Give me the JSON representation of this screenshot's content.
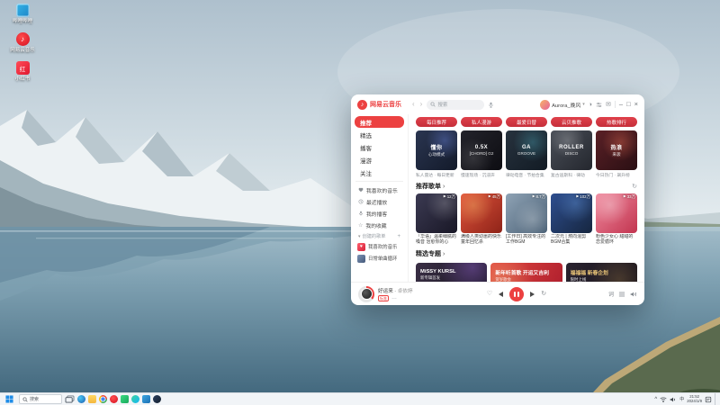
{
  "accent_color": "#ec4141",
  "desktop": {
    "icons": [
      {
        "label": "哔哩哔哩"
      },
      {
        "label": "网易云音乐"
      },
      {
        "label": "小红书"
      }
    ]
  },
  "taskbar": {
    "search_placeholder": "搜索",
    "apps": [
      "task-view",
      "edge",
      "file-explorer",
      "chrome",
      "netease-music",
      "wechat",
      "qq-music",
      "vscode",
      "steam"
    ],
    "tray": {
      "lang": "中",
      "time": "21:52",
      "date": "2024/1/9"
    }
  },
  "app": {
    "name": "网易云音乐",
    "header": {
      "search_placeholder": "搜索",
      "user_name": "Aurora_晚风"
    },
    "sidebar": {
      "nav": [
        {
          "label": "推荐"
        },
        {
          "label": "精选"
        },
        {
          "label": "播客"
        },
        {
          "label": "漫游"
        },
        {
          "label": "关注"
        }
      ],
      "library": [
        {
          "label": "我喜欢的音乐"
        },
        {
          "label": "最近播放"
        },
        {
          "label": "我的播客"
        },
        {
          "label": "我的收藏"
        }
      ],
      "playlists_header": "创建的歌单",
      "playlists": [
        {
          "title": "我喜欢的音乐"
        },
        {
          "title": "日常单曲循环"
        }
      ]
    },
    "main": {
      "chips": [
        {
          "label": "每日推荐"
        },
        {
          "label": "私人漫游"
        },
        {
          "label": "最爱日替"
        },
        {
          "label": "云贝推歌"
        },
        {
          "label": "热歌排行"
        }
      ],
      "featured_cards": [
        {
          "line1": "懂你",
          "line2": "心动模式",
          "caption": "私人雷达 · 每日更新"
        },
        {
          "line1": "0.5X",
          "line2": "[CHORD] G2",
          "caption": "慢速现场 · 沉浸声"
        },
        {
          "line1": "GA",
          "line2": "GROOVE",
          "caption": "律动电音 · 节拍合集"
        },
        {
          "line1": "ROLLER",
          "line2": "DISCO",
          "caption": "复古迪斯科 · 律动"
        },
        {
          "line1": "热浪",
          "line2": "来袭",
          "caption": "今日热门 · 飙升榜"
        }
      ],
      "section_recommend": {
        "title": "推荐歌单",
        "more": "›"
      },
      "recommend_playlists": [
        {
          "plays": "12万",
          "title": "「华语」温柔细腻的嗓音 治愈你的心"
        },
        {
          "plays": "45万",
          "title": "满级人类幼崽的快乐 童年回忆杀"
        },
        {
          "plays": "8.7万",
          "title": "[工作日] 高效专注的工作BGM"
        },
        {
          "plays": "102万",
          "title": "二次元 | 燃向混剪BGM合集"
        },
        {
          "plays": "33万",
          "title": "粉色少女心 甜甜的恋爱循环"
        }
      ],
      "section_featured": {
        "title": "精选专题",
        "more": "›"
      },
      "banners": [
        {
          "title": "MiSSY KURSL",
          "subtitle": "新专辑首发"
        },
        {
          "title": "新年听首歌 开运又吉利",
          "subtitle": "贺岁歌会"
        },
        {
          "title": "福福福 新春企划",
          "subtitle": "限时上线"
        }
      ]
    },
    "player": {
      "song": "好运来",
      "artist": "卓依婷",
      "quality": "标准",
      "lyrics_label": "词"
    }
  }
}
